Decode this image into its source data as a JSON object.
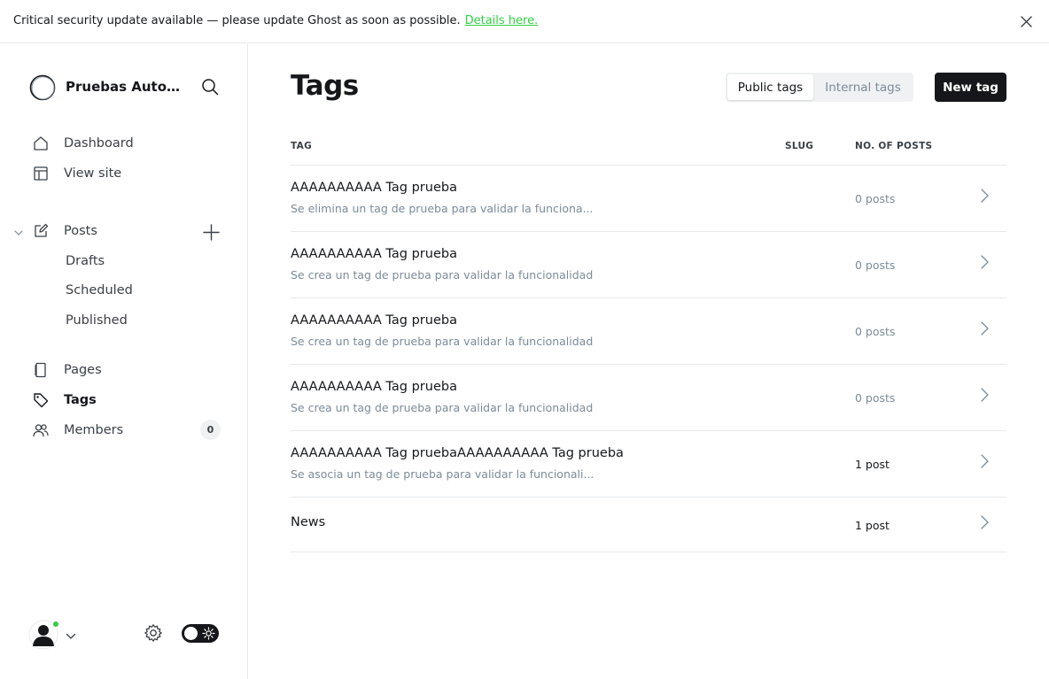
{
  "banner": {
    "text": "Critical security update available — please update Ghost as soon as possible.",
    "link": "Details here."
  },
  "sidebar": {
    "site_title": "Pruebas Automa...",
    "nav": {
      "dashboard": "Dashboard",
      "view_site": "View site",
      "posts": "Posts",
      "drafts": "Drafts",
      "scheduled": "Scheduled",
      "published": "Published",
      "pages": "Pages",
      "tags": "Tags",
      "members": "Members",
      "members_count": "0"
    }
  },
  "main": {
    "title": "Tags",
    "filters": {
      "public": "Public tags",
      "internal": "Internal tags"
    },
    "new_tag": "New tag",
    "table": {
      "headers": {
        "tag": "TAG",
        "slug": "SLUG",
        "posts": "NO. OF POSTS"
      },
      "rows": [
        {
          "name": "AAAAAAAAAA Tag prueba",
          "description": "Se elimina un tag de prueba para validar la funciona...",
          "count": "0 posts"
        },
        {
          "name": "AAAAAAAAAA Tag prueba",
          "description": "Se crea un tag de prueba para validar la funcionalidad",
          "count": "0 posts"
        },
        {
          "name": "AAAAAAAAAA Tag prueba",
          "description": "Se crea un tag de prueba para validar la funcionalidad",
          "count": "0 posts"
        },
        {
          "name": "AAAAAAAAAA Tag prueba",
          "description": "Se crea un tag de prueba para validar la funcionalidad",
          "count": "0 posts"
        },
        {
          "name": "AAAAAAAAAA Tag pruebaAAAAAAAAAA Tag prueba",
          "description": "Se asocia un tag de prueba para validar la funcionali...",
          "count": "1 post"
        },
        {
          "name": "News",
          "description": "",
          "count": "1 post"
        }
      ]
    }
  },
  "colors": {
    "accent_green": "#30cf43",
    "primary_dark": "#15171a",
    "muted_text": "#7c8b9a",
    "divider": "#e6e9eb"
  },
  "icons": [
    "close-icon",
    "site-logo-icon",
    "search-icon",
    "home-icon",
    "layout-icon",
    "edit-icon",
    "chevron-down-icon",
    "plus-icon",
    "page-icon",
    "tag-icon",
    "members-icon",
    "user-avatar-icon",
    "gear-icon",
    "moon-icon",
    "sun-icon",
    "chevron-right-icon"
  ]
}
